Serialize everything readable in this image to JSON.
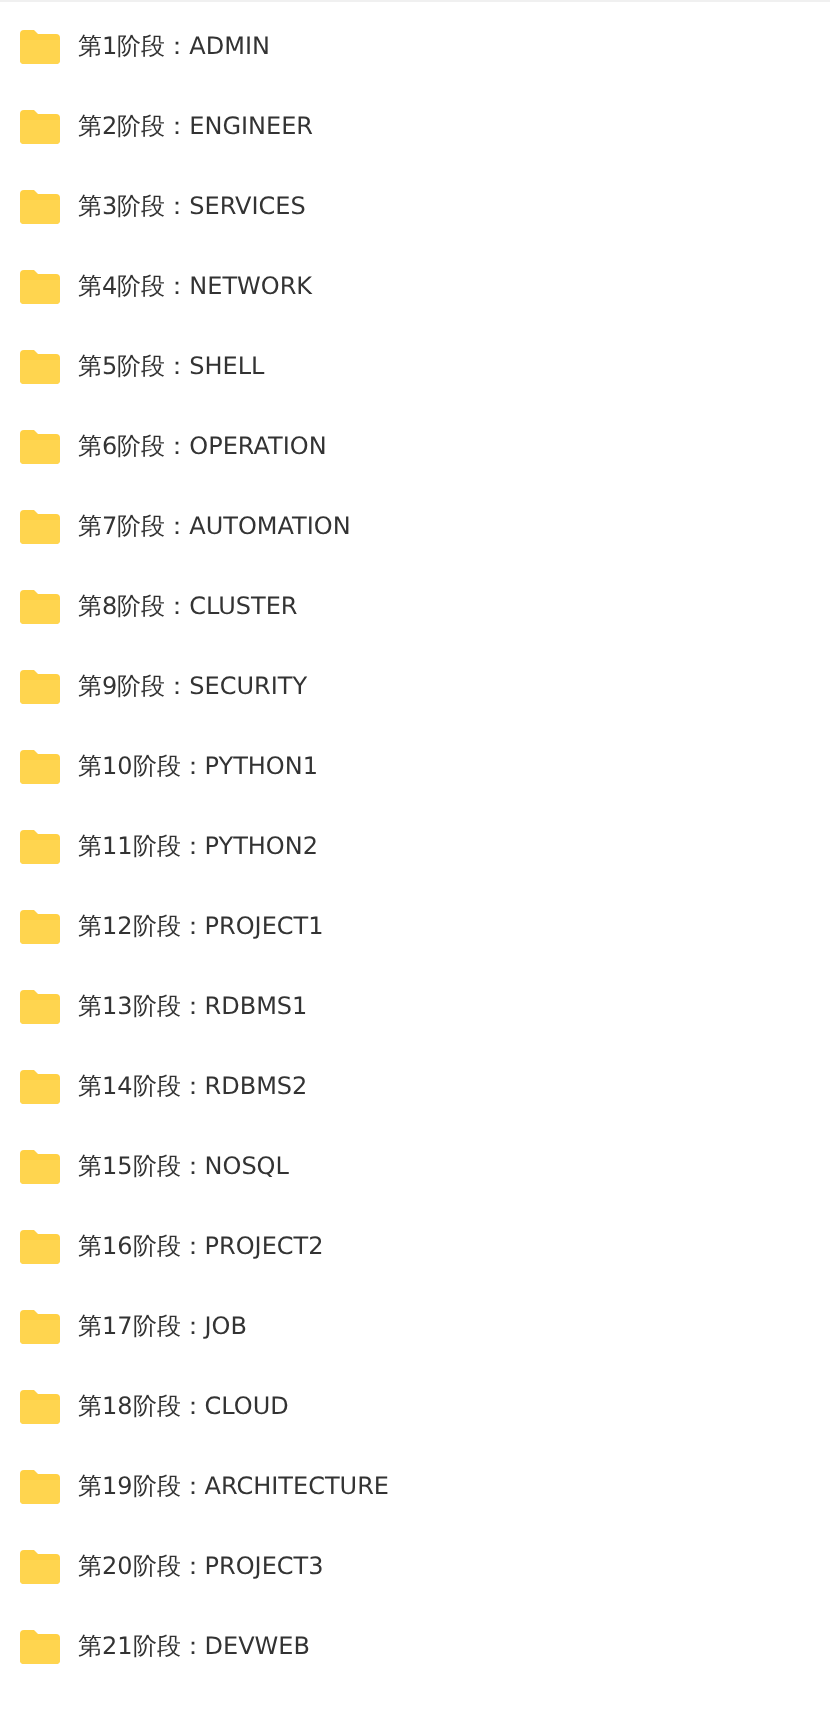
{
  "folders": [
    {
      "name": "第1阶段：ADMIN"
    },
    {
      "name": "第2阶段：ENGINEER"
    },
    {
      "name": "第3阶段：SERVICES"
    },
    {
      "name": "第4阶段：NETWORK"
    },
    {
      "name": "第5阶段：SHELL"
    },
    {
      "name": "第6阶段：OPERATION"
    },
    {
      "name": "第7阶段：AUTOMATION"
    },
    {
      "name": "第8阶段：CLUSTER"
    },
    {
      "name": "第9阶段：SECURITY"
    },
    {
      "name": "第10阶段：PYTHON1"
    },
    {
      "name": "第11阶段：PYTHON2"
    },
    {
      "name": "第12阶段：PROJECT1"
    },
    {
      "name": "第13阶段：RDBMS1"
    },
    {
      "name": "第14阶段：RDBMS2"
    },
    {
      "name": "第15阶段：NOSQL"
    },
    {
      "name": "第16阶段：PROJECT2"
    },
    {
      "name": "第17阶段：JOB"
    },
    {
      "name": "第18阶段：CLOUD"
    },
    {
      "name": "第19阶段：ARCHITECTURE"
    },
    {
      "name": "第20阶段：PROJECT3"
    },
    {
      "name": "第21阶段：DEVWEB"
    }
  ]
}
